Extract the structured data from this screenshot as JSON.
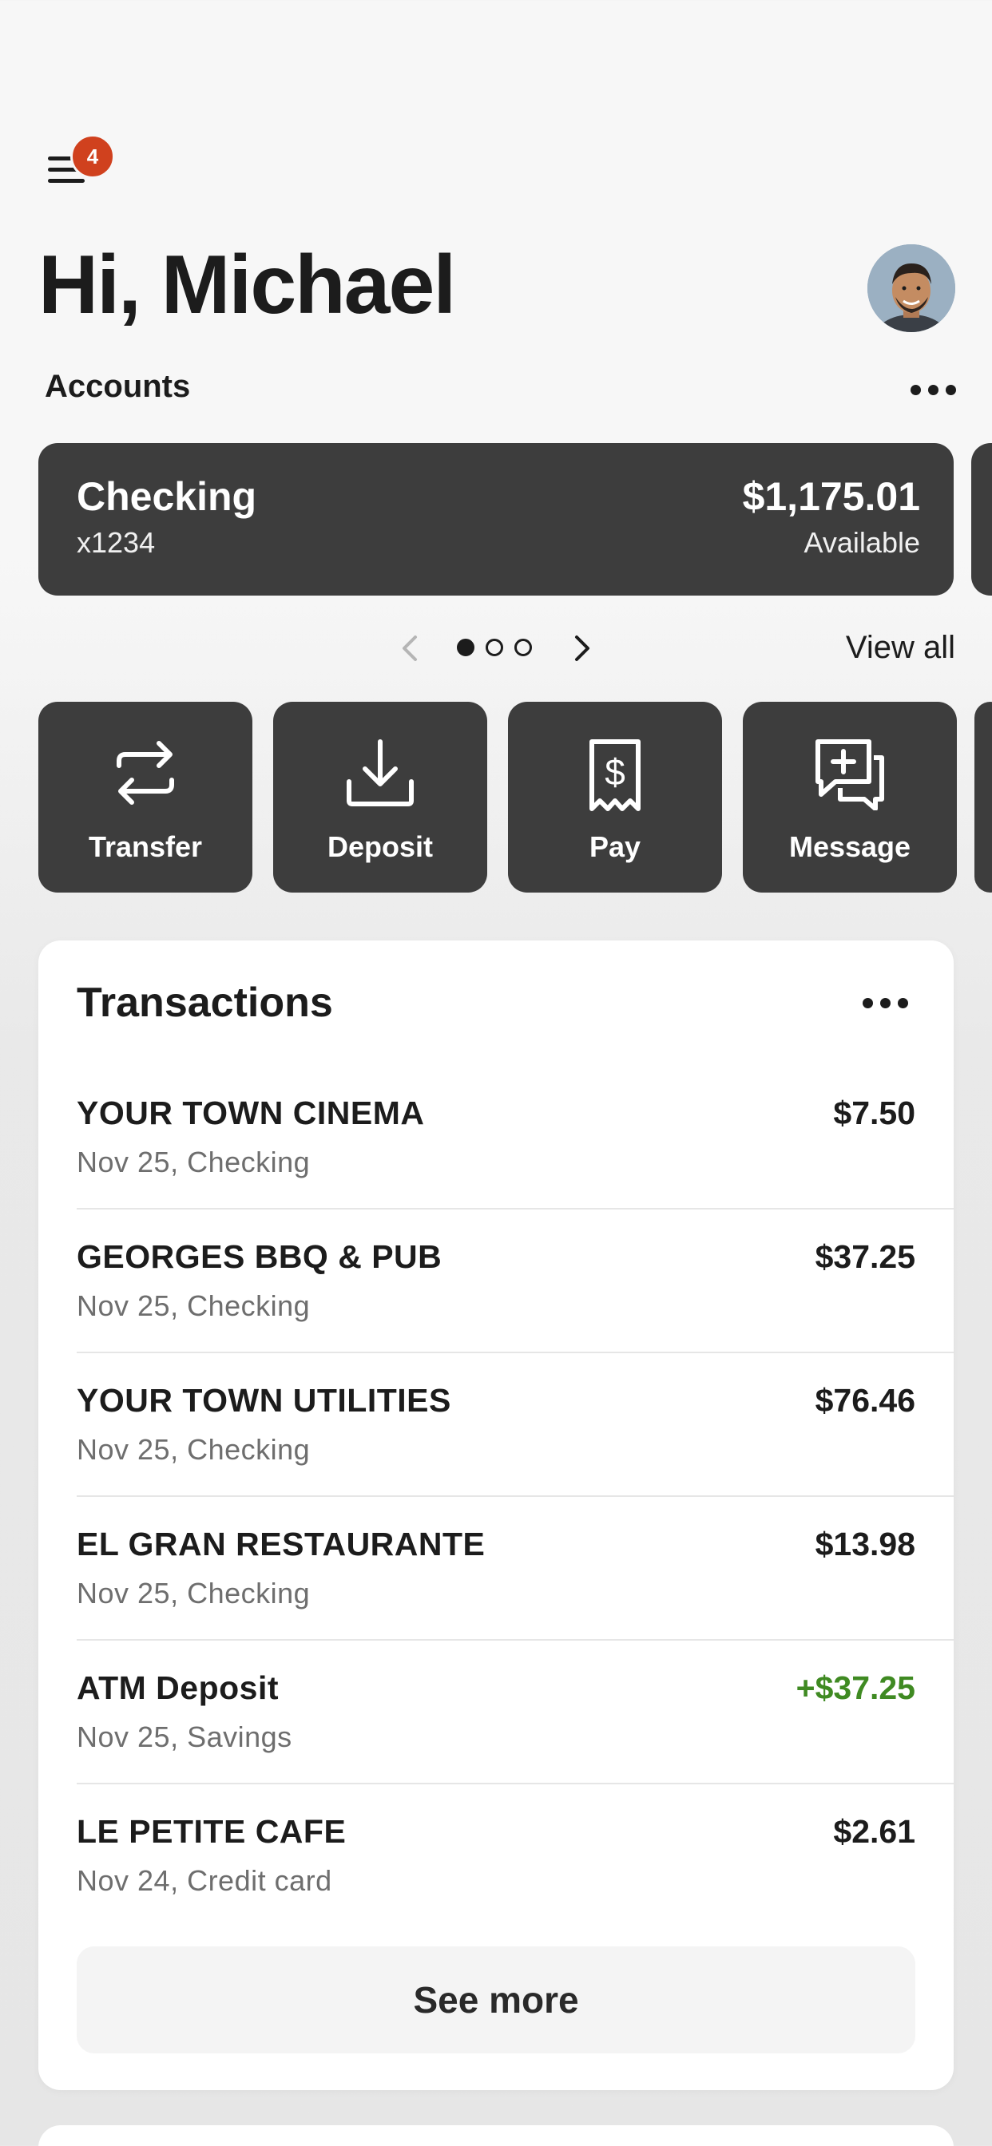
{
  "header": {
    "menu_badge_count": "4",
    "greeting": "Hi, Michael"
  },
  "accounts": {
    "label": "Accounts",
    "card": {
      "name": "Checking",
      "number": "x1234",
      "balance": "$1,175.01",
      "balance_label": "Available"
    },
    "pager": {
      "pages": 3,
      "current": 1
    },
    "view_all": "View all"
  },
  "actions": [
    {
      "label": "Transfer",
      "icon": "transfer-icon"
    },
    {
      "label": "Deposit",
      "icon": "deposit-icon"
    },
    {
      "label": "Pay",
      "icon": "pay-icon"
    },
    {
      "label": "Message",
      "icon": "message-icon"
    }
  ],
  "transactions": {
    "title": "Transactions",
    "items": [
      {
        "merchant": "YOUR TOWN CINEMA",
        "detail": "Nov 25, Checking",
        "amount": "$7.50"
      },
      {
        "merchant": "GEORGES BBQ & PUB",
        "detail": "Nov 25, Checking",
        "amount": "$37.25"
      },
      {
        "merchant": "YOUR TOWN UTILITIES",
        "detail": "Nov 25, Checking",
        "amount": "$76.46"
      },
      {
        "merchant": "EL GRAN RESTAURANTE",
        "detail": "Nov 25, Checking",
        "amount": "$13.98"
      },
      {
        "merchant": "ATM Deposit",
        "detail": "Nov 25, Savings",
        "amount": "+$37.25"
      },
      {
        "merchant": "LE PETITE CAFE",
        "detail": "Nov 24, Credit card",
        "amount": "$2.61"
      }
    ],
    "see_more": "See more"
  },
  "colors": {
    "card_dark": "#3d3d3d",
    "badge": "#d0411e",
    "credit_green": "#3f8a22"
  }
}
